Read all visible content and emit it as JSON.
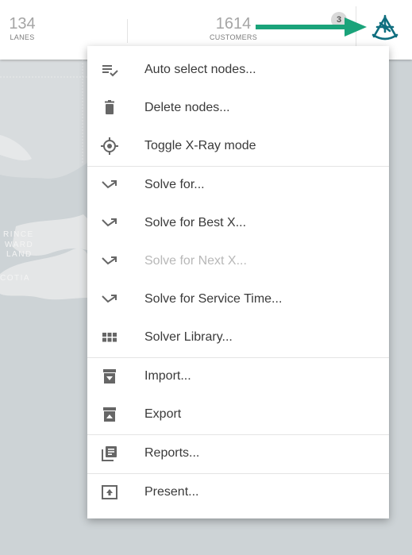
{
  "header": {
    "stats": [
      {
        "value": "134",
        "label": "LANES"
      },
      {
        "value": "1614",
        "label": "CUSTOMERS"
      }
    ],
    "badge": "3",
    "menu_icon": "sextant-icon"
  },
  "map_labels": {
    "line1": "RINCE",
    "line2": "WARD",
    "line3": "LAND",
    "line4": "COTIA"
  },
  "menu": {
    "items": [
      {
        "label": "Auto select nodes...",
        "icon": "playlist-check-icon",
        "disabled": false
      },
      {
        "label": "Delete nodes...",
        "icon": "trash-icon",
        "disabled": false
      },
      {
        "label": "Toggle X-Ray mode",
        "icon": "crosshair-icon",
        "disabled": false
      },
      {
        "label": "Solve for...",
        "icon": "trend-arrow-icon",
        "disabled": false
      },
      {
        "label": "Solve for Best X...",
        "icon": "trend-arrow-icon",
        "disabled": false
      },
      {
        "label": "Solve for Next X...",
        "icon": "trend-arrow-icon",
        "disabled": true
      },
      {
        "label": "Solve for Service Time...",
        "icon": "trend-arrow-icon",
        "disabled": false
      },
      {
        "label": "Solver Library...",
        "icon": "grid-icon",
        "disabled": false
      },
      {
        "label": "Import...",
        "icon": "archive-down-icon",
        "disabled": false
      },
      {
        "label": "Export",
        "icon": "archive-up-icon",
        "disabled": false
      },
      {
        "label": "Reports...",
        "icon": "library-books-icon",
        "disabled": false
      },
      {
        "label": "Present...",
        "icon": "present-upload-icon",
        "disabled": false
      }
    ]
  },
  "colors": {
    "accent": "#0f6e7f",
    "arrow": "#1aa37a",
    "map_water": "#cdd3d6",
    "map_land": "#e4e6e7"
  }
}
